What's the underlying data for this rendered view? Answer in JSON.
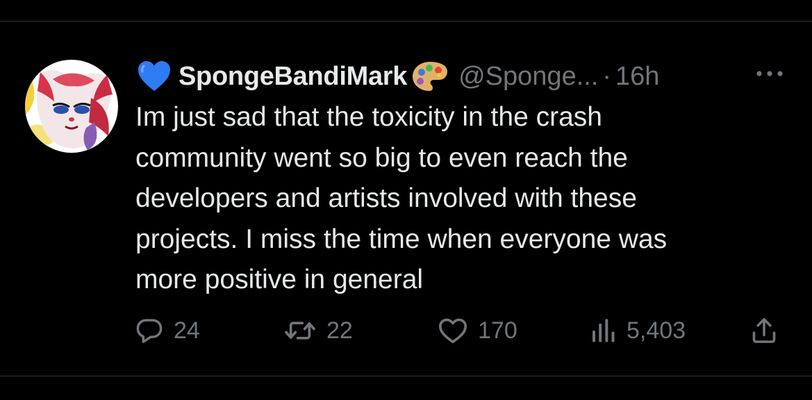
{
  "tweet": {
    "author": {
      "display_name": "SpongeBandiMark",
      "handle": "@Sponge...",
      "name_prefix_emoji": "blue-heart",
      "name_suffix_emoji": "artist-palette"
    },
    "separator": "·",
    "time": "16h",
    "text": "Im just sad that the toxicity in the crash\ncommunity went so big to even reach the\ndevelopers and artists involved with these\nprojects. I miss the time when everyone was\nmore positive in general",
    "metrics": {
      "replies": "24",
      "retweets": "22",
      "likes": "170",
      "views": "5,403"
    }
  },
  "colors": {
    "background": "#000000",
    "text_primary": "#e7e9ea",
    "text_secondary": "#71767b",
    "divider": "#2f3336",
    "heart_blue": "#2e7bf6"
  },
  "icons": {
    "more": "more-horizontal-icon",
    "reply": "reply-icon",
    "retweet": "retweet-icon",
    "like": "heart-icon",
    "views": "views-bar-chart-icon",
    "share": "share-icon"
  }
}
